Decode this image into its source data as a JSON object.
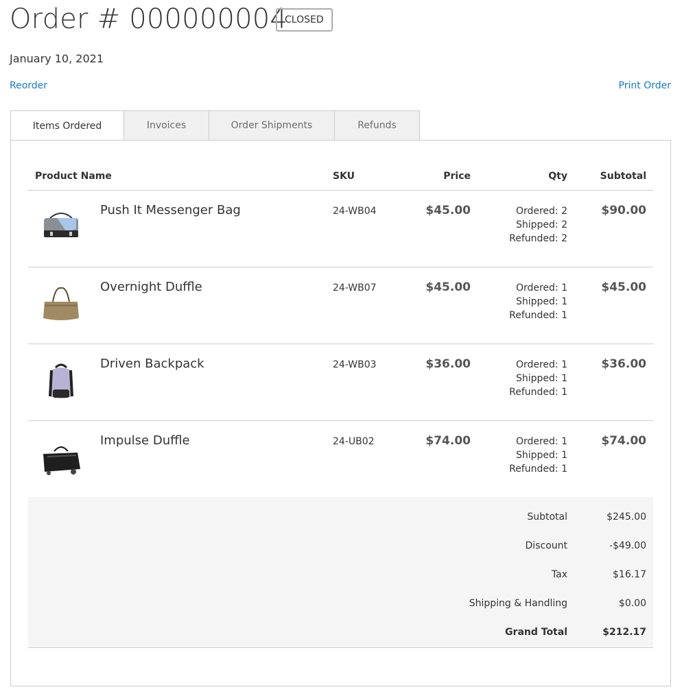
{
  "order": {
    "title": "Order # 000000004",
    "status": "CLOSED",
    "date": "January 10, 2021"
  },
  "actions": {
    "reorder": "Reorder",
    "print": "Print Order"
  },
  "tabs": [
    {
      "label": "Items Ordered",
      "active": true
    },
    {
      "label": "Invoices",
      "active": false
    },
    {
      "label": "Order Shipments",
      "active": false
    },
    {
      "label": "Refunds",
      "active": false
    }
  ],
  "table": {
    "headers": {
      "product": "Product Name",
      "sku": "SKU",
      "price": "Price",
      "qty": "Qty",
      "subtotal": "Subtotal"
    },
    "rows": [
      {
        "name": "Push It Messenger Bag",
        "sku": "24-WB04",
        "price": "$45.00",
        "ordered": "Ordered: 2",
        "shipped": "Shipped: 2",
        "refunded": "Refunded: 2",
        "subtotal": "$90.00",
        "thumb": "messenger-bag-thumbnail"
      },
      {
        "name": "Overnight Duffle",
        "sku": "24-WB07",
        "price": "$45.00",
        "ordered": "Ordered: 1",
        "shipped": "Shipped: 1",
        "refunded": "Refunded: 1",
        "subtotal": "$45.00",
        "thumb": "duffle-thumbnail"
      },
      {
        "name": "Driven Backpack",
        "sku": "24-WB03",
        "price": "$36.00",
        "ordered": "Ordered: 1",
        "shipped": "Shipped: 1",
        "refunded": "Refunded: 1",
        "subtotal": "$36.00",
        "thumb": "backpack-thumbnail"
      },
      {
        "name": "Impulse Duffle",
        "sku": "24-UB02",
        "price": "$74.00",
        "ordered": "Ordered: 1",
        "shipped": "Shipped: 1",
        "refunded": "Refunded: 1",
        "subtotal": "$74.00",
        "thumb": "rolling-duffle-thumbnail"
      }
    ]
  },
  "totals": {
    "subtotal_label": "Subtotal",
    "subtotal": "$245.00",
    "discount_label": "Discount",
    "discount": "-$49.00",
    "tax_label": "Tax",
    "tax": "$16.17",
    "shipping_label": "Shipping & Handling",
    "shipping": "$0.00",
    "grand_label": "Grand Total",
    "grand": "$212.17"
  },
  "colors": {
    "link": "#1979c3",
    "border": "#cccccc",
    "tab_inactive": "#f0f0f0",
    "totals_bg": "#f5f5f5"
  }
}
